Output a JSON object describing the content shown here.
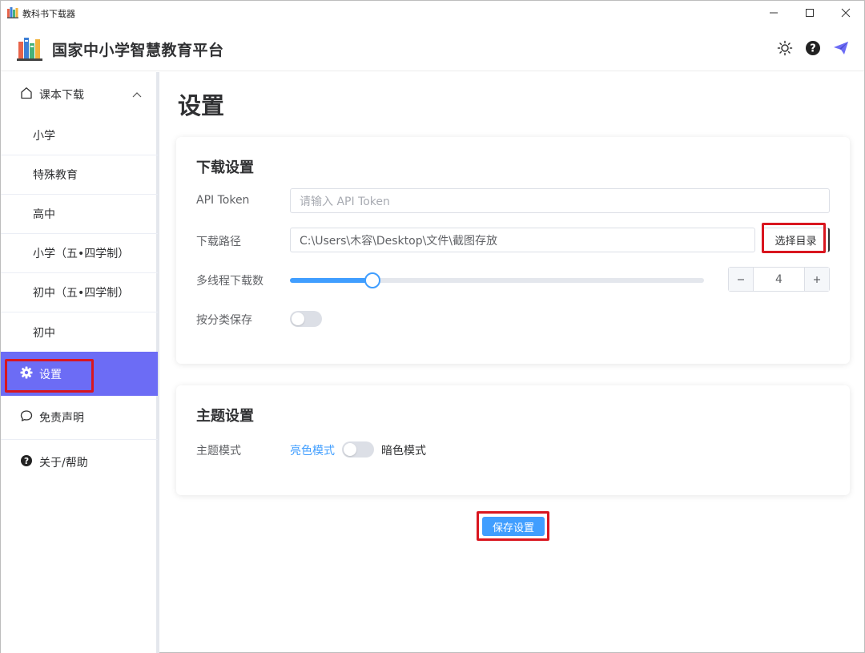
{
  "window": {
    "title": "教科书下载器",
    "icon": "books-icon",
    "controls": [
      "minimize-icon",
      "maximize-icon",
      "close-icon"
    ]
  },
  "header": {
    "title": "国家中小学智慧教育平台",
    "icons": [
      "sun-icon",
      "help-icon",
      "send-icon"
    ]
  },
  "sidebar": {
    "parent": {
      "label": "课本下载",
      "icon": "home-icon",
      "expanded": true
    },
    "sub_items": [
      {
        "label": "小学"
      },
      {
        "label": "特殊教育"
      },
      {
        "label": "高中"
      },
      {
        "label": "小学（五•四学制）"
      },
      {
        "label": "初中（五•四学制）"
      },
      {
        "label": "初中"
      }
    ],
    "items": [
      {
        "label": "设置",
        "icon": "gear-icon",
        "active": true
      },
      {
        "label": "免责声明",
        "icon": "chat-bubble-icon",
        "active": false
      },
      {
        "label": "关于/帮助",
        "icon": "help-icon",
        "active": false
      }
    ]
  },
  "main": {
    "title": "设置",
    "download": {
      "title": "下载设置",
      "token_label": "API Token",
      "token_placeholder": "请输入 API Token",
      "token_value": "",
      "path_label": "下载路径",
      "path_value": "C:\\Users\\木容\\Desktop\\文件\\截图存放",
      "pick_button": "选择目录",
      "threads_label": "多线程下载数",
      "threads_value": "4",
      "threads_slider_fraction": 0.2,
      "category_label": "按分类保存",
      "category_on": false
    },
    "theme": {
      "title": "主题设置",
      "mode_label": "主题模式",
      "light_label": "亮色模式",
      "dark_label": "暗色模式",
      "dark_on": false
    },
    "save_button": "保存设置"
  },
  "colors": {
    "accent": "#409eff",
    "active_nav": "#6c6cf5",
    "highlight": "#d9161f"
  }
}
